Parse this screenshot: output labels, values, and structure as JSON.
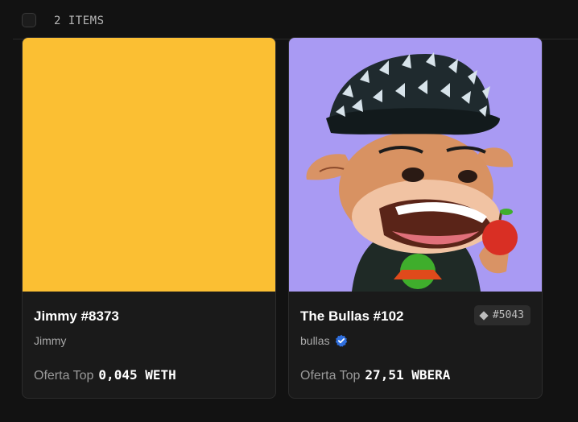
{
  "toolbar": {
    "items_count_label": "2 ITEMS"
  },
  "cards": [
    {
      "name": "Jimmy #8373",
      "collection": "Jimmy",
      "verified": false,
      "offer_label": "Oferta Top",
      "offer_amount": "0,045 WETH",
      "image_color": "#FBBF33"
    },
    {
      "name": "The Bullas #102",
      "collection": "bullas",
      "verified": true,
      "rank": "#5043",
      "offer_label": "Oferta Top",
      "offer_amount": "27,51 WBERA",
      "image_color": "#A99AF3"
    }
  ],
  "colors": {
    "background": "#121212",
    "card": "#1a1a1a",
    "verified_badge": "#2f6fde"
  }
}
